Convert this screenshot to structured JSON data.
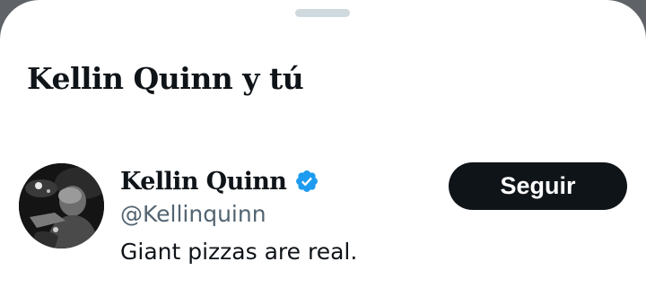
{
  "sheet": {
    "title": "Kellin Quinn y tú"
  },
  "user": {
    "display_name": "Kellin Quinn",
    "handle": "@Kellinquinn",
    "bio": "Giant pizzas are real.",
    "verified": true,
    "verified_icon": "verified-badge-icon",
    "avatar_icon": "profile-photo"
  },
  "actions": {
    "follow_label": "Seguir"
  },
  "colors": {
    "primary_text": "#0f1419",
    "secondary_text": "#536471",
    "verified_blue": "#1d9bf0",
    "button_bg": "#0f1419",
    "button_text": "#ffffff",
    "handle_bar": "#cfd9de"
  }
}
